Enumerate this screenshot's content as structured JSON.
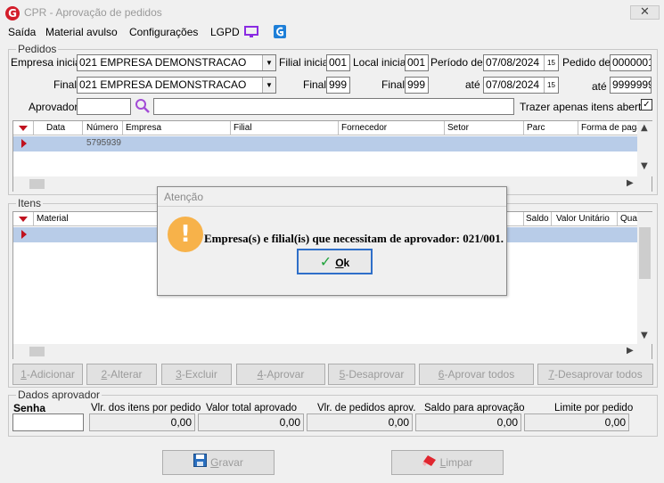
{
  "window": {
    "title": "CPR - Aprovação de pedidos",
    "app_icon": "G",
    "close": "✕"
  },
  "menu": {
    "items": [
      "Saída",
      "Material avulso",
      "Configurações",
      "LGPD"
    ]
  },
  "pedidos": {
    "group_title": "Pedidos",
    "empresa_inicial_label": "Empresa inicial",
    "empresa_inicial_value": "021 EMPRESA DEMONSTRACAO",
    "empresa_final_label": "Final",
    "empresa_final_value": "021 EMPRESA DEMONSTRACAO",
    "filial_inicial_label": "Filial inicial",
    "filial_inicial_value": "001",
    "filial_final_label": "Final",
    "filial_final_value": "999",
    "local_inicial_label": "Local inicial",
    "local_inicial_value": "001",
    "local_final_label": "Final",
    "local_final_value": "999",
    "periodo_label": "Período de",
    "periodo_de_value": "07/08/2024",
    "periodo_ate_label": "até",
    "periodo_ate_value": "07/08/2024",
    "calendar_glyph": "15",
    "pedido_de_label": "Pedido de",
    "pedido_de_value": "0000001",
    "pedido_ate_label": "até",
    "pedido_ate_value": "9999999",
    "aprovador_label": "Aprovador",
    "aprovador_value": "",
    "trazer_label": "Trazer apenas itens abertos",
    "trazer_checked": "✓",
    "columns": [
      "Data",
      "Número",
      "Empresa",
      "Filial",
      "Fornecedor",
      "Setor",
      "Parc",
      "Forma de paga"
    ],
    "row": {
      "numero": "5795939"
    }
  },
  "itens": {
    "group_title": "Itens",
    "columns": [
      "Material",
      "Saldo",
      "Valor Unitário",
      "Quan"
    ]
  },
  "actions": {
    "adicionar": {
      "key": "1",
      "label": "-Adicionar"
    },
    "alterar": {
      "key": "2",
      "label": "-Alterar"
    },
    "excluir": {
      "key": "3",
      "label": "-Excluir"
    },
    "aprovar": {
      "key": "4",
      "label": "-Aprovar"
    },
    "desaprovar": {
      "key": "5",
      "label": "-Desaprovar"
    },
    "aprovar_todos": {
      "key": "6",
      "label": "-Aprovar todos"
    },
    "desaprovar_todos": {
      "key": "7",
      "label": "-Desaprovar todos"
    }
  },
  "dados_aprovador": {
    "group_title": "Dados aprovador",
    "senha_label": "Senha",
    "vlr_itens_label": "Vlr. dos itens por pedido",
    "vlr_itens_value": "0,00",
    "valor_total_label": "Valor total aprovado",
    "valor_total_value": "0,00",
    "vlr_pedidos_label": "Vlr. de pedidos aprov.",
    "vlr_pedidos_value": "0,00",
    "saldo_label": "Saldo para aprovação",
    "saldo_value": "0,00",
    "limite_label": "Limite por pedido",
    "limite_value": "0,00"
  },
  "bottom": {
    "gravar_key": "G",
    "gravar_rest": "ravar",
    "limpar_key": "L",
    "limpar_rest": "impar"
  },
  "dialog": {
    "title": "Atenção",
    "icon": "!",
    "message": "Empresa(s) e filial(is) que necessitam de aprovador: 021/001.",
    "ok_key": "O",
    "ok_rest": "k"
  },
  "colors": {
    "accent": "#c0121f",
    "selection": "#b8cce8",
    "focus": "#2f6fc9",
    "warning": "#f7b24a"
  }
}
